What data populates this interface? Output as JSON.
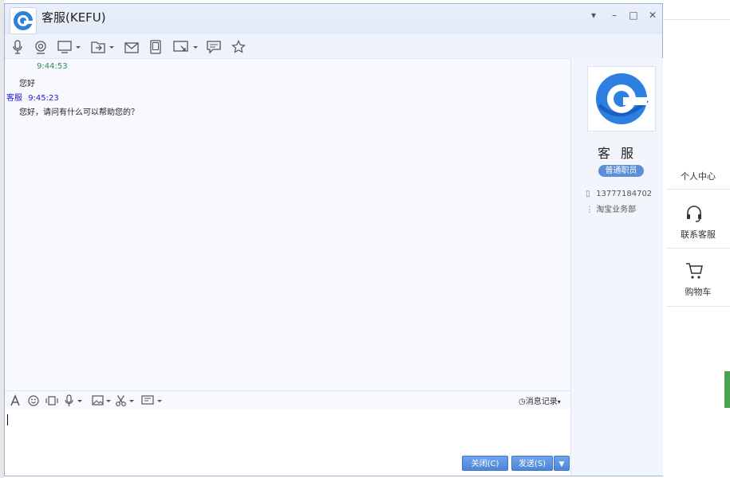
{
  "window": {
    "title": "客服(KEFU)",
    "controls": {
      "dropdown": "▾",
      "minimize": "–",
      "maximize": "□",
      "close": "✕"
    }
  },
  "toolbar": {
    "icons": [
      "microphone-icon",
      "camera-icon",
      "screen-share-icon",
      "file-transfer-icon",
      "mail-icon",
      "mobile-icon",
      "remote-desktop-icon",
      "message-board-icon",
      "favorite-star-icon"
    ]
  },
  "messages": [
    {
      "sender": "",
      "time": "9:44:53",
      "text": "您好"
    },
    {
      "sender": "客服",
      "time": "9:45:23",
      "text": "您好，请问有什么可以帮助您的？"
    }
  ],
  "contact": {
    "name": "客 服",
    "role": "普通职员",
    "phone": "13777184702",
    "department": "淘宝业务部"
  },
  "input_toolbar": {
    "history_label": "消息记录"
  },
  "buttons": {
    "close": "关闭(C)",
    "send": "发送(S)"
  },
  "background_sidebar": {
    "personal_center": "个人中心",
    "contact_service": "联系客服",
    "cart": "购物车"
  },
  "colors": {
    "accent": "#4c86d8",
    "time_received": "#2e8b57",
    "time_sent": "#1a1ad6",
    "badge": "#5b8fd9"
  }
}
